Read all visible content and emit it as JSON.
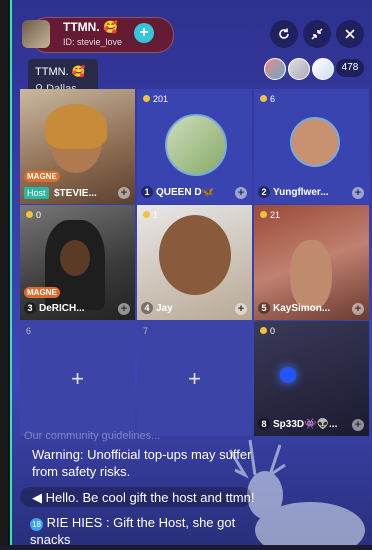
{
  "header": {
    "host_name": "TTMN. 🥰",
    "host_id": "ID: stevie_love",
    "follow_symbol": "+",
    "refresh_icon": "refresh-icon",
    "minimize_icon": "minimize-icon",
    "close_icon": "close-icon",
    "viewer_count": "478"
  },
  "tooltip": {
    "name": "TTMN. 🥰",
    "location": "Dallas"
  },
  "tiles": [
    {
      "hearts": "",
      "label_tag": "Host",
      "label": "$TEVIE...",
      "badge": "MAGNE"
    },
    {
      "hearts": "201",
      "num": "1",
      "label": "QUEEN D🦋"
    },
    {
      "hearts": "6",
      "num": "2",
      "label": "Yungflwer..."
    },
    {
      "hearts": "0",
      "num": "3",
      "label": "DeRICH...",
      "badge": "MAGNE"
    },
    {
      "hearts": "1",
      "num": "4",
      "label": "Jay"
    },
    {
      "hearts": "21",
      "num": "5",
      "label": "KaySimon..."
    },
    {
      "slot": "6"
    },
    {
      "slot": "7"
    },
    {
      "hearts": "0",
      "num": "8",
      "label": "Sp33D👾👽..."
    }
  ],
  "chat": {
    "warning": "Warning: Unofficial top-ups may suffer from safety risks.",
    "announcement": "Hello. Be cool gift the host and ttmn!",
    "message_level": "18",
    "message_user": "RIE HIES",
    "message_text": ": Gift the Host, she got snacks",
    "faded_text": "Our community guidelines..."
  },
  "colors": {
    "accent": "#2de6c8",
    "follow": "#36c6d9",
    "header_pill": "#7a1414",
    "coin": "#f2c23a"
  }
}
